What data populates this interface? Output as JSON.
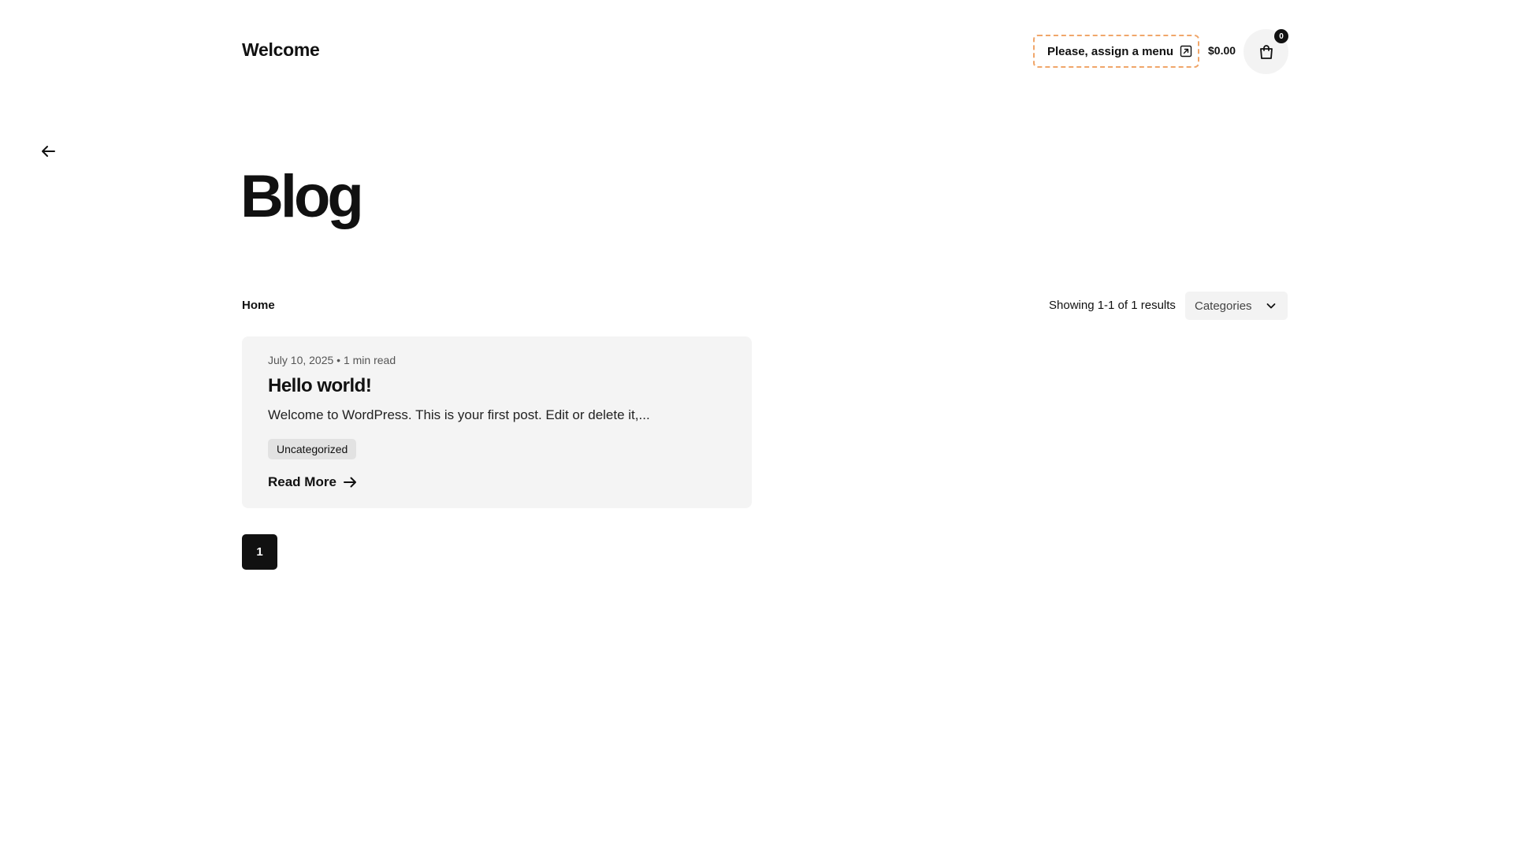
{
  "header": {
    "site_title": "Welcome",
    "menu_placeholder": "Please, assign a menu",
    "cart_total": "$0.00",
    "cart_count": "0"
  },
  "icons": {
    "back": "arrow-left-icon",
    "external": "external-link-icon",
    "cart": "shopping-bag-icon",
    "chevron": "chevron-down-icon",
    "read_more": "arrow-right-icon"
  },
  "main": {
    "page_title": "Blog",
    "breadcrumb": "Home",
    "results_count": "Showing 1-1 of 1 results",
    "category_select": {
      "selected": "Categories"
    }
  },
  "posts": [
    {
      "meta": "July 10, 2025 • 1 min read",
      "title": "Hello world!",
      "excerpt": "Welcome to WordPress. This is your first post. Edit or delete it,...",
      "category": "Uncategorized",
      "read_more": "Read More"
    }
  ],
  "pagination": {
    "current": "1"
  }
}
